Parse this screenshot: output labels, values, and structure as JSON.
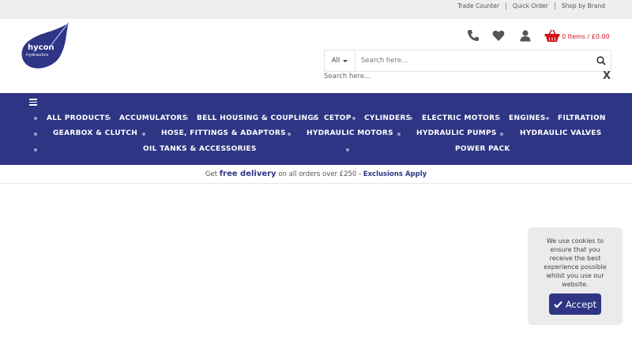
{
  "top_links": [
    "Trade Counter",
    "Quick Order",
    "Shop by Brand"
  ],
  "logo": {
    "line1": "hycon",
    "line2": "hydraulics"
  },
  "header": {
    "cart_text": "0 Items / £0.00"
  },
  "search": {
    "category": "All",
    "placeholder": "Search here...",
    "mobile_placeholder": "Search here...",
    "close": "X"
  },
  "nav": {
    "items": [
      "ALL PRODUCTS",
      "ACCUMULATORS",
      "BELL HOUSING & COUPLINGS",
      "CETOP",
      "CYLINDERS",
      "ELECTRIC MOTORS",
      "ENGINES",
      "FILTRATION",
      "GEARBOX & CLUTCH",
      "HOSE, FITTINGS & ADAPTORS",
      "HYDRAULIC MOTORS",
      "HYDRAULIC PUMPS",
      "HYDRAULIC VALVES",
      "OIL TANKS & ACCESSORIES",
      "POWER PACK"
    ]
  },
  "delivery": {
    "prefix": "Get ",
    "highlight": "free delivery",
    "middle": " on all orders over £250 - ",
    "link": "Exclusions Apply"
  },
  "cookie": {
    "message": "We use cookies to ensure that you receive the best experience possible whilst you use our website.",
    "accept": "Accept"
  },
  "colors": {
    "brand": "#2e3584",
    "cart": "#d0121b",
    "topbar": "#eeeeee"
  }
}
